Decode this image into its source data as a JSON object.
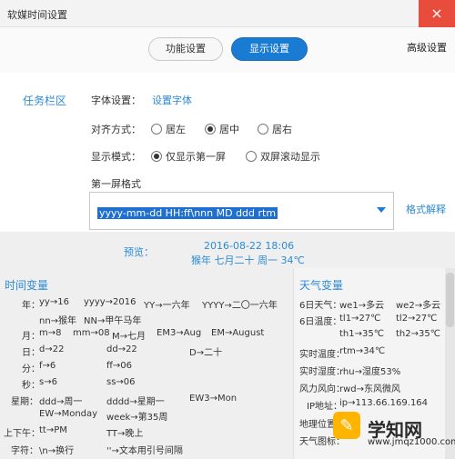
{
  "window": {
    "title": "软媒时间设置",
    "close_label": "×"
  },
  "tabs": [
    {
      "label": "功能设置"
    },
    {
      "label": "显示设置"
    },
    {
      "label": "高级设置"
    }
  ],
  "section": {
    "label": "任务栏区"
  },
  "font": {
    "label": "字体设置：",
    "link": "设置字体"
  },
  "align": {
    "label": "对齐方式：",
    "options": [
      {
        "label": "居左"
      },
      {
        "label": "居中"
      },
      {
        "label": "居右"
      }
    ]
  },
  "display_mode": {
    "label": "显示模式：",
    "options": [
      {
        "label": "仅显示第一屏"
      },
      {
        "label": "双屏滚动显示"
      }
    ]
  },
  "first_screen": {
    "label": "第一屏格式",
    "value": "yyyy-mm-dd HH:ff\\nnn MD ddd rtm",
    "help_link": "格式解释"
  },
  "preview": {
    "label": "预览：",
    "line1": "2016-08-22 18:06",
    "line2": "猴年 七月二十 周一 34℃"
  },
  "time_vars": {
    "title": "时间变量",
    "rows": [
      [
        "年：",
        "yy→16",
        "yyyy→2016",
        "YY→一六年",
        "YYYY→二〇一六年"
      ],
      [
        "",
        "nn→猴年",
        "NN→甲午马年",
        "",
        ""
      ],
      [
        "月：",
        "m→8",
        "mm→08",
        "M→七月",
        "EM3→Aug",
        "EM→August"
      ],
      [
        "日：",
        "d→22",
        "dd→22",
        "D→二十"
      ],
      [
        "分：",
        "f→6",
        "ff→06"
      ],
      [
        "秒：",
        "s→6",
        "ss→06"
      ],
      [
        "星期：",
        "ddd→周一",
        "dddd→星期一",
        "EW3→Mon"
      ],
      [
        "",
        "EW→Monday",
        "week→第35周"
      ],
      [
        "上下午：",
        "tt→PM",
        "TT→晚上"
      ],
      [
        "字符：",
        "\\n→换行",
        "''→文本用引号间隔"
      ]
    ]
  },
  "weather_vars": {
    "title": "天气变量",
    "rows": [
      [
        "6日天气：",
        "we1→多云",
        "we2→多云"
      ],
      [
        "6日温度：",
        "tl1→27℃",
        "tl2→27℃"
      ],
      [
        "",
        "th1→35℃",
        "th2→35℃"
      ],
      [
        "实时温度：",
        "rtm→34℃"
      ],
      [
        "实时湿度：",
        "rhu→湿度53%"
      ],
      [
        "风力风向：",
        "rwd→东风微风"
      ],
      [
        "IP地址：",
        "ip→113.66.169.164"
      ],
      [
        "地理位置："
      ],
      [
        "天气图标："
      ]
    ]
  },
  "watermark": {
    "text": "学知网",
    "sub": "www.jmqz1000.com"
  }
}
